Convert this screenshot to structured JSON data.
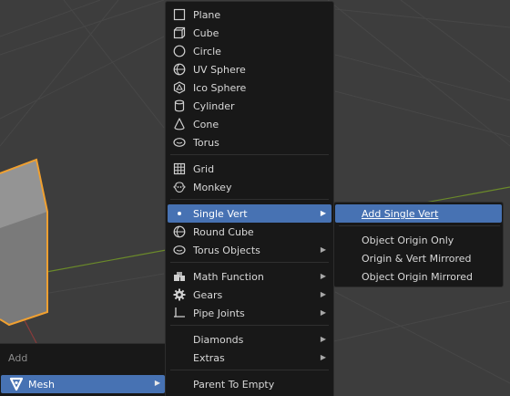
{
  "add_menu": {
    "title": "Add",
    "mesh_label": "Mesh"
  },
  "mesh_menu": {
    "items": [
      {
        "label": "Plane",
        "icon": "plane-icon"
      },
      {
        "label": "Cube",
        "icon": "cube-icon"
      },
      {
        "label": "Circle",
        "icon": "circle-icon"
      },
      {
        "label": "UV Sphere",
        "icon": "uv-sphere-icon"
      },
      {
        "label": "Ico Sphere",
        "icon": "ico-sphere-icon"
      },
      {
        "label": "Cylinder",
        "icon": "cylinder-icon"
      },
      {
        "label": "Cone",
        "icon": "cone-icon"
      },
      {
        "label": "Torus",
        "icon": "torus-icon"
      },
      {
        "label": "Grid",
        "icon": "grid-icon"
      },
      {
        "label": "Monkey",
        "icon": "monkey-icon"
      },
      {
        "label": "Single Vert",
        "icon": "vertex-icon"
      },
      {
        "label": "Round Cube",
        "icon": "round-cube-icon"
      },
      {
        "label": "Torus Objects",
        "icon": "torus-icon"
      },
      {
        "label": "Math Function",
        "icon": "math-function-icon"
      },
      {
        "label": "Gears",
        "icon": "gear-icon"
      },
      {
        "label": "Pipe Joints",
        "icon": "pipe-joint-icon"
      },
      {
        "label": "Diamonds"
      },
      {
        "label": "Extras"
      },
      {
        "label": "Parent To Empty"
      }
    ]
  },
  "single_vert_menu": {
    "items": [
      {
        "label": "Add Single Vert"
      },
      {
        "label": "Object Origin Only"
      },
      {
        "label": "Origin & Vert Mirrored"
      },
      {
        "label": "Object Origin Mirrored"
      }
    ]
  },
  "colors": {
    "highlight": "#4772b3",
    "menu_bg": "#181818",
    "selection_outline": "#f0a030"
  }
}
